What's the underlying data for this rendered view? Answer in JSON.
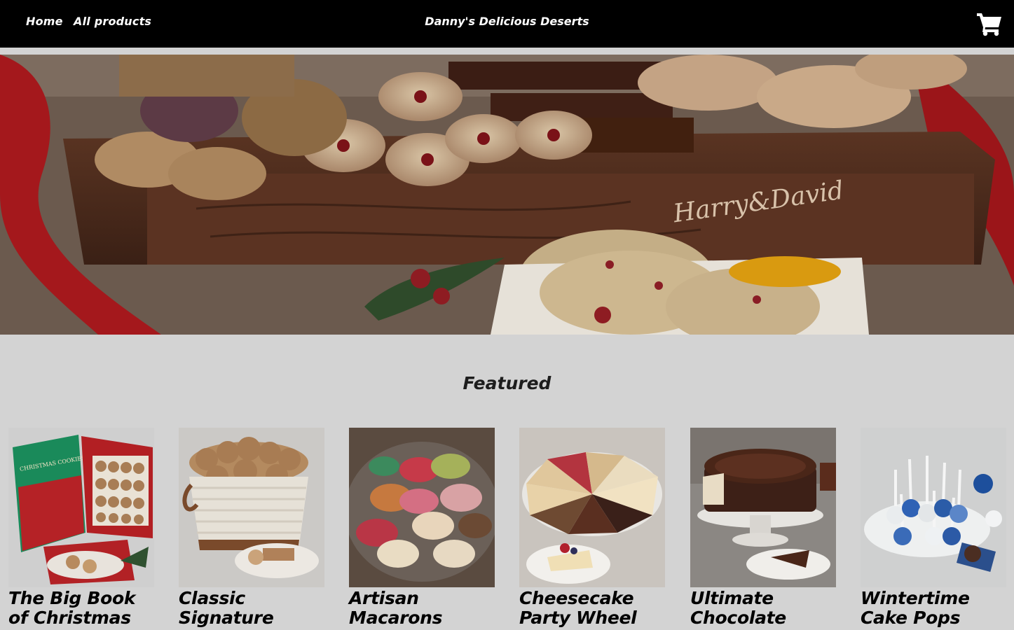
{
  "nav": {
    "home_label": "Home",
    "all_products_label": "All products",
    "brand": "Danny's Delicious Deserts",
    "cart_icon": "cart-icon"
  },
  "hero": {
    "box_engraving": "Harry&David"
  },
  "featured": {
    "title": "Featured",
    "products": [
      {
        "name": "The Big Book of Christmas Cookies",
        "image_text": "CHRISTMAS COOKIES"
      },
      {
        "name": "Classic Signature Cookie Gift"
      },
      {
        "name": "Artisan Macarons"
      },
      {
        "name": "Cheesecake Party Wheel"
      },
      {
        "name": "Ultimate Chocolate Cake"
      },
      {
        "name": "Wintertime Cake Pops"
      }
    ]
  },
  "colors": {
    "topbar": "#000000",
    "page_background": "#d3d3d3",
    "text": "#000000"
  }
}
